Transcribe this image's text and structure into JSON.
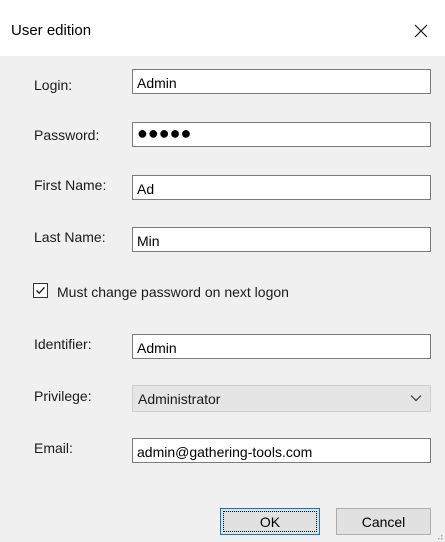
{
  "window": {
    "title": "User edition",
    "close_icon": "close-icon"
  },
  "form": {
    "login": {
      "label": "Login:",
      "value": "Admin"
    },
    "password": {
      "label": "Password:",
      "value": "●●●●●"
    },
    "first_name": {
      "label": "First Name:",
      "value": "Ad"
    },
    "last_name": {
      "label": "Last Name:",
      "value": "Min"
    },
    "must_change": {
      "label": "Must change password on next logon",
      "checked": true
    },
    "identifier": {
      "label": "Identifier:",
      "value": "Admin"
    },
    "privilege": {
      "label": "Privilege:",
      "selected": "Administrator"
    },
    "email": {
      "label": "Email:",
      "value": "admin@gathering-tools.com"
    }
  },
  "buttons": {
    "ok": "OK",
    "cancel": "Cancel"
  },
  "colors": {
    "window_bg": "#f0f0f0",
    "accent": "#0078d7"
  }
}
